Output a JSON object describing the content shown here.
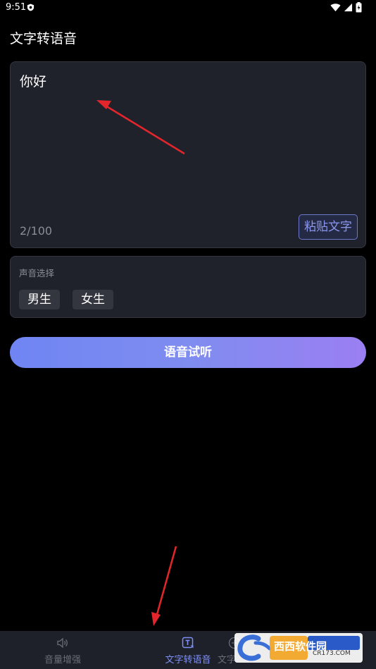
{
  "status_bar": {
    "time": "9:51"
  },
  "page": {
    "title": "文字转语音"
  },
  "text_input": {
    "value": "你好",
    "count": "2/100",
    "paste_label": "粘贴文字"
  },
  "voice": {
    "label": "声音选择",
    "options": [
      "男生",
      "女生"
    ]
  },
  "listen_button": {
    "label": "语音试听"
  },
  "nav": {
    "items": [
      {
        "label": "音量增强",
        "icon": "speaker-icon"
      },
      {
        "label": "文字转语音",
        "icon": "text-to-speech-icon",
        "active": true
      },
      {
        "label": "文字",
        "icon": "add-circle-icon"
      }
    ]
  },
  "watermark": {
    "brand": "西西软件园",
    "site": "CR173.COM"
  },
  "colors": {
    "background": "#000000",
    "card": "#20222b",
    "accent": "#7d8ff5",
    "gradient_start": "#6f85f3",
    "gradient_end": "#9b7ff2",
    "annotation_arrow": "#e3262b"
  }
}
